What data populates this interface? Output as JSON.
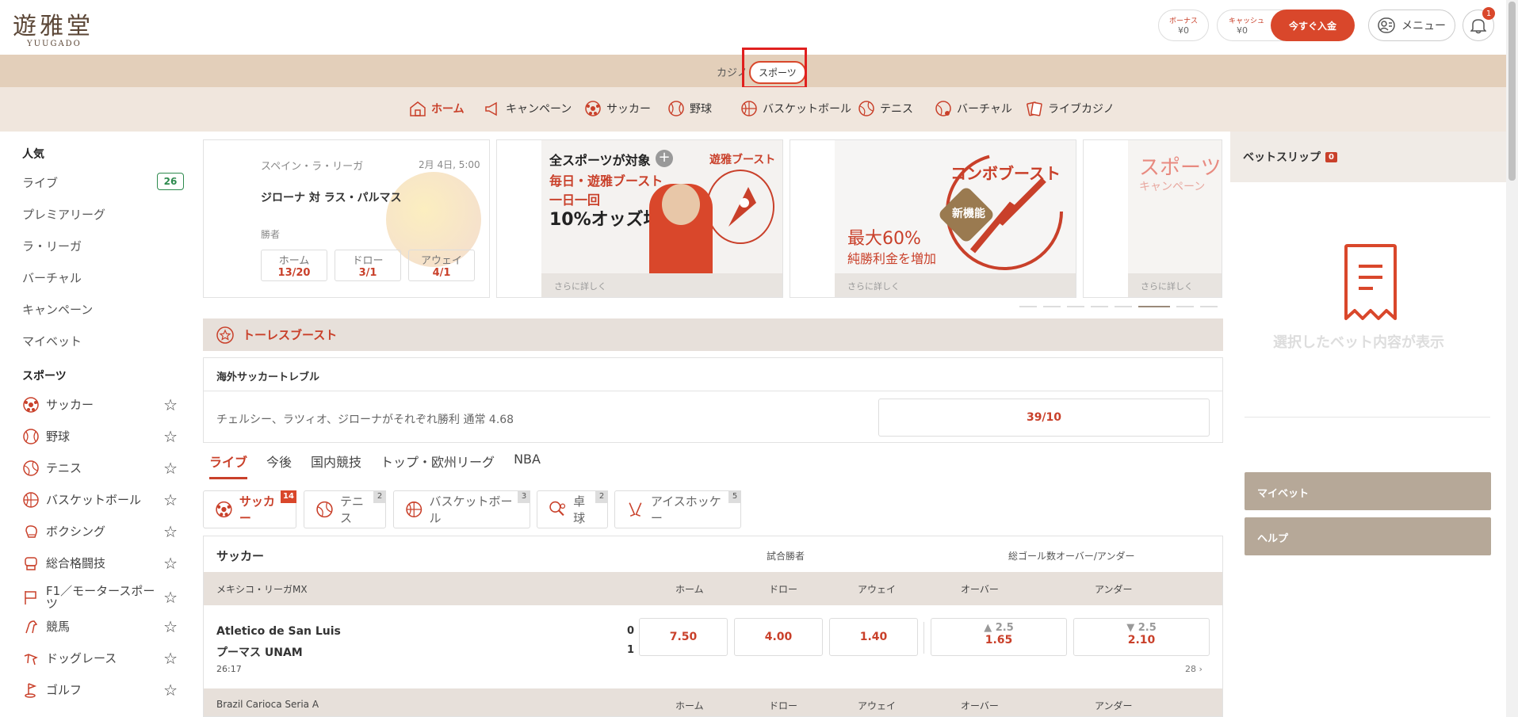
{
  "header": {
    "logo_main": "遊雅堂",
    "logo_sub": "YUUGADO",
    "bonus_label": "ボーナス",
    "bonus_value": "¥0",
    "cash_label": "キャッシュ",
    "cash_value": "¥0",
    "deposit": "今すぐ入金",
    "menu": "メニュー",
    "notifications": "1"
  },
  "mode": {
    "casino": "カジノ",
    "sports": "スポーツ"
  },
  "nav": [
    "ホーム",
    "キャンペーン",
    "サッカー",
    "野球",
    "バスケットボール",
    "テニス",
    "バーチャル",
    "ライブカジノ"
  ],
  "sidebar": {
    "popular_head": "人気",
    "popular": [
      "ライブ",
      "プレミアリーグ",
      "ラ・リーガ",
      "バーチャル",
      "キャンペーン",
      "マイベット"
    ],
    "live_count": "26",
    "sports_head": "スポーツ",
    "sports": [
      "サッカー",
      "野球",
      "テニス",
      "バスケットボール",
      "ボクシング",
      "総合格闘技",
      "F1／モータースポーツ",
      "競馬",
      "ドッグレース",
      "ゴルフ"
    ]
  },
  "featured": {
    "league": "スペイン・ラ・リーガ",
    "time": "2月 4日, 5:00",
    "match": "ジローナ 対 ラス・パルマス",
    "market": "勝者",
    "home_label": "ホーム",
    "home_odd": "13/20",
    "draw_label": "ドロー",
    "draw_odd": "3/1",
    "away_label": "アウェイ",
    "away_odd": "4/1"
  },
  "promos": [
    {
      "line1": "全スポーツが対象",
      "line2": "毎日・遊雅ブースト",
      "line3": "一日一回",
      "line4": "10%オッズ増強",
      "brand": "遊雅ブースト",
      "more": "さらに詳しく"
    },
    {
      "title": "コンボブースト",
      "badge": "新機能",
      "big": "最大60%",
      "small": "純勝利金を増加",
      "more": "さらに詳しく"
    },
    {
      "title": "スポーツ",
      "sub": "キャンペーン",
      "more": "さらに詳しく"
    }
  ],
  "boost_section": "トーレスブースト",
  "treble": {
    "head": "海外サッカートレブル",
    "desc": "チェルシー、ラツィオ、ジローナがそれぞれ勝利 通常 4.68",
    "odd": "39/10"
  },
  "tabs": [
    "ライブ",
    "今後",
    "国内競技",
    "トップ・欧州リーグ",
    "NBA"
  ],
  "chips": [
    {
      "label": "サッカー",
      "count": "14"
    },
    {
      "label": "テニス",
      "count": "2"
    },
    {
      "label": "バスケットボール",
      "count": "3"
    },
    {
      "label": "卓球",
      "count": "2"
    },
    {
      "label": "アイスホッケー",
      "count": "5"
    }
  ],
  "table": {
    "title": "サッカー",
    "col_winner": "試合勝者",
    "col_goals": "総ゴール数オーバー/アンダー",
    "league1": "メキシコ・リーガMX",
    "league2": "Brazil Carioca Seria A",
    "h_home": "ホーム",
    "h_draw": "ドロー",
    "h_away": "アウェイ",
    "h_over": "オーバー",
    "h_under": "アンダー",
    "team1": "Atletico de San Luis",
    "team2": "プーマス UNAM",
    "score1": "0",
    "score2": "1",
    "time": "26:17",
    "more": "28",
    "odd_home": "7.50",
    "odd_draw": "4.00",
    "odd_away": "1.40",
    "over_line": "▲ 2.5",
    "over_odd": "1.65",
    "under_line": "▼ 2.5",
    "under_odd": "2.10"
  },
  "betslip": {
    "head": "ベットスリップ",
    "count": "0",
    "empty": "選択したベット内容が表示",
    "mybets": "マイベット",
    "help": "ヘルプ"
  },
  "colors": {
    "accent": "#d9472b",
    "beige": "#e3cfba",
    "nav_bg": "#f0e6dd"
  }
}
